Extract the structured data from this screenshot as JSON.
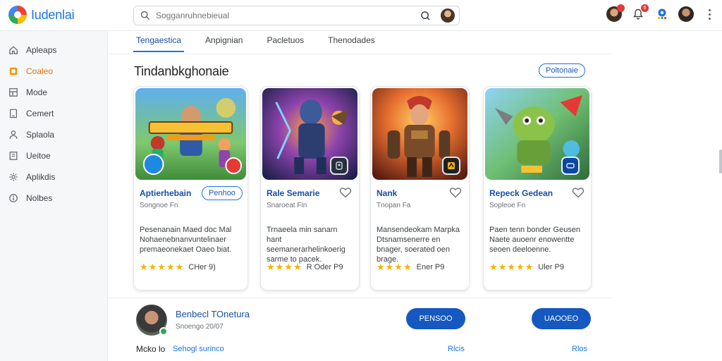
{
  "app": {
    "logo_text": "Iudenlai"
  },
  "search": {
    "placeholder": "Sogganruhnebieual"
  },
  "sidebar": {
    "items": [
      {
        "label": "Apleaps",
        "icon": "home-icon",
        "active": false
      },
      {
        "label": "Coaleo",
        "icon": "apps-icon",
        "active": true
      },
      {
        "label": "Mode",
        "icon": "grid-icon",
        "active": false
      },
      {
        "label": "Cemert",
        "icon": "tablet-icon",
        "active": false
      },
      {
        "label": "Splaola",
        "icon": "person-icon",
        "active": false
      },
      {
        "label": "Ueitoe",
        "icon": "book-icon",
        "active": false
      },
      {
        "label": "Aplikdis",
        "icon": "gear-icon",
        "active": false
      },
      {
        "label": "Nolbes",
        "icon": "info-icon",
        "active": false
      }
    ]
  },
  "topbar": {
    "notification_count": "6"
  },
  "tabs": [
    {
      "label": "Tengaestica",
      "active": true
    },
    {
      "label": "Anpignian",
      "active": false
    },
    {
      "label": "Pacletuos",
      "active": false
    },
    {
      "label": "Thenodades",
      "active": false
    }
  ],
  "section": {
    "title": "Tindanbkghonaie",
    "see_all": "Poltonaie"
  },
  "cards": [
    {
      "name": "Aptierhebain",
      "sub": "Songnoe Fn",
      "install_label": "Penhoo",
      "desc": "Pesenanain Maed doc Mal Nohaenebnanvuntelinaer premaeonekaet Oaeo biat.",
      "stars": "★★★★★",
      "rating_text": "CHer 9)"
    },
    {
      "name": "Rale Semarie",
      "sub": "Snaroeat Fin",
      "desc": "Trnaeela min sanarn hant seemanerarhelinkoerig sarme to pacek.",
      "stars": "★★★★",
      "rating_text": "R Oder P9"
    },
    {
      "name": "Nank",
      "sub": "Tnopan Fa",
      "desc": "Mansendeokam Marpka Dtsnamsenerre en bnager, soerated oen brage.",
      "stars": "★★★★",
      "rating_text": "Ener P9"
    },
    {
      "name": "Repeck Gedean",
      "sub": "Sopleoe Fn",
      "desc": "Paen tenn bonder Geusen Naete auoenr enowentte seoen deeloenne.",
      "stars": "★★★★★",
      "rating_text": "Uler P9"
    }
  ],
  "developer": {
    "name": "Benbecl TOnetura",
    "sub": "Snoengo 20/07",
    "primary_label": "PENSOO",
    "secondary_label": "UAOOEO"
  },
  "footer": {
    "label": "Mcko lo",
    "link_main": "Sehogl surinco",
    "link_mid": "Rlcis",
    "link_end": "Rlos"
  },
  "colors": {
    "accent": "#1a73e8",
    "brand_dark": "#174ea6",
    "button": "#1558c0",
    "active_nav": "#e8710a",
    "star": "#f4b400"
  }
}
